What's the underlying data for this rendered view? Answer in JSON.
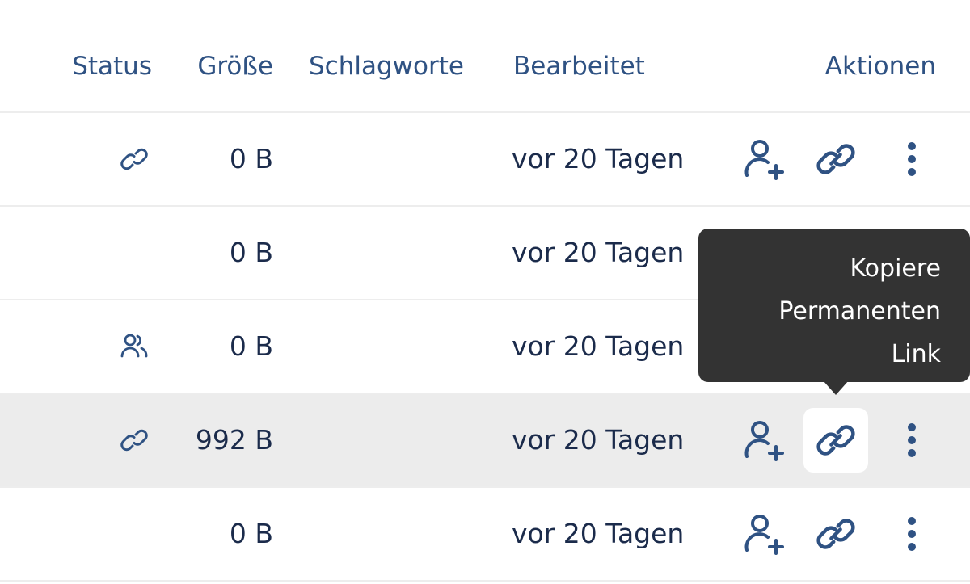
{
  "header": {
    "status": "Status",
    "size": "Größe",
    "tags": "Schlagworte",
    "edited": "Bearbeitet",
    "actions": "Aktionen"
  },
  "rows": [
    {
      "status_icon": "link-icon",
      "size": "0 B",
      "edited": "vor 20 Tagen",
      "tags": ""
    },
    {
      "status_icon": "",
      "size": "0 B",
      "edited": "vor 20 Tagen",
      "tags": ""
    },
    {
      "status_icon": "users-icon",
      "size": "0 B",
      "edited": "vor 20 Tagen",
      "tags": ""
    },
    {
      "status_icon": "link-icon",
      "size": "992 B",
      "edited": "vor 20 Tagen",
      "tags": ""
    },
    {
      "status_icon": "",
      "size": "0 B",
      "edited": "vor 20 Tagen",
      "tags": ""
    }
  ],
  "tooltip": {
    "text": "Kopiere\nPermanenten\nLink"
  },
  "colors": {
    "header_text": "#2f5283",
    "body_text": "#1b2b4b",
    "icon": "#2f5283",
    "row_highlight": "#ececec",
    "tooltip_bg": "#333333"
  }
}
